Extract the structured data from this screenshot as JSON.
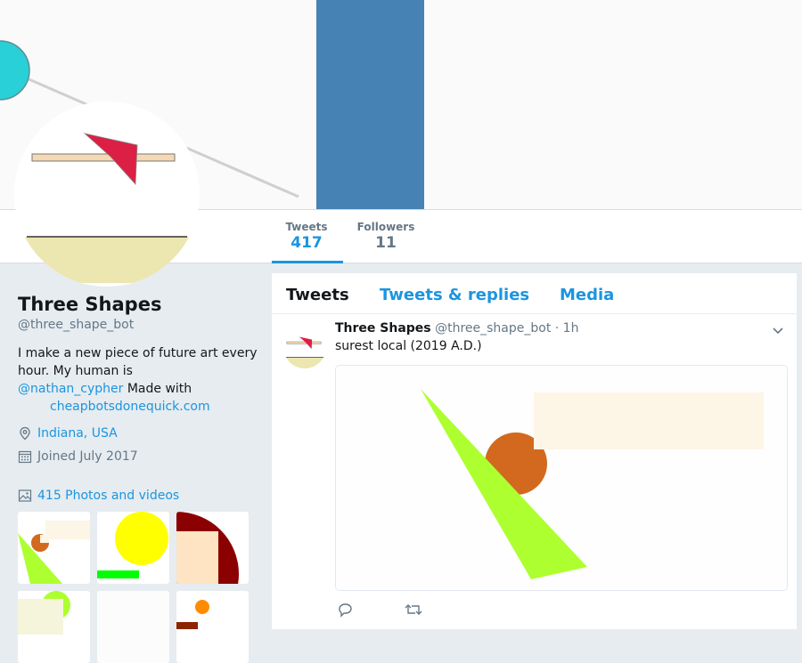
{
  "stats": {
    "tweets_label": "Tweets",
    "tweets_value": "417",
    "followers_label": "Followers",
    "followers_value": "11"
  },
  "profile": {
    "name": "Three Shapes",
    "handle": "@three_shape_bot",
    "bio_text": "I make a new piece of future art every hour. My human is",
    "bio_mention": "@nathan_cypher",
    "bio_made_with": "Made with",
    "bio_link": "cheapbotsdonequick.com",
    "location": "Indiana, USA",
    "joined": "Joined July 2017",
    "photos_label": "415 Photos and videos"
  },
  "timeline": {
    "tabs": [
      "Tweets",
      "Tweets & replies",
      "Media"
    ],
    "tweet": {
      "author": "Three Shapes",
      "handle": "@three_shape_bot",
      "time": "· 1h",
      "text": "surest local (2019 A.D.)"
    }
  },
  "icons": {
    "location": "location-pin-icon",
    "calendar": "calendar-icon",
    "photos": "image-icon",
    "reply": "reply-icon",
    "retweet": "retweet-icon",
    "caret": "chevron-down-icon"
  },
  "colors": {
    "accent": "#1b95e0",
    "banner_rect": "#4682b4",
    "banner_circle": "#2ad0d8"
  }
}
